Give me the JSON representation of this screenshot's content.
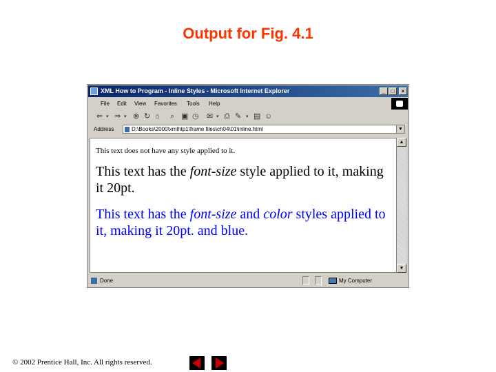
{
  "slide": {
    "title": "Output for Fig. 4.1",
    "copyright": "© 2002 Prentice Hall, Inc.  All rights reserved."
  },
  "window": {
    "title": "XML How to Program - Inline Styles - Microsoft Internet Explorer",
    "controls": {
      "minimize": "_",
      "maximize": "□",
      "close": "×"
    },
    "menu": [
      "File",
      "Edit",
      "View",
      "Favorites",
      "Tools",
      "Help"
    ],
    "toolbar_icons": [
      "back-icon",
      "forward-icon",
      "stop-icon",
      "refresh-icon",
      "home-icon",
      "search-icon",
      "favorites-icon",
      "history-icon",
      "mail-icon",
      "print-icon",
      "edit-icon",
      "discuss-icon",
      "messenger-icon"
    ],
    "address": {
      "label": "Address",
      "url": "D:\\Books\\2000\\xmlhtp1\\frame files\\ch04\\01\\inline.html"
    },
    "status": {
      "text": "Done",
      "zone": "My Computer"
    }
  },
  "content": {
    "line1": "This text does not have any style applied to it.",
    "line2_before": "This text has the ",
    "line2_em": "font-size",
    "line2_after": " style applied to it, making it 20pt.",
    "line3_before": "This text has the ",
    "line3_em1": "font-size",
    "line3_mid": " and ",
    "line3_em2": "color",
    "line3_after": " styles applied to it, making it 20pt. and blue."
  },
  "colors": {
    "title": "#ff3300",
    "titlebar": "#0a246a",
    "blue_text": "#0000ff",
    "nav_buttons": "#000000",
    "nav_arrows": "#cc0000"
  }
}
